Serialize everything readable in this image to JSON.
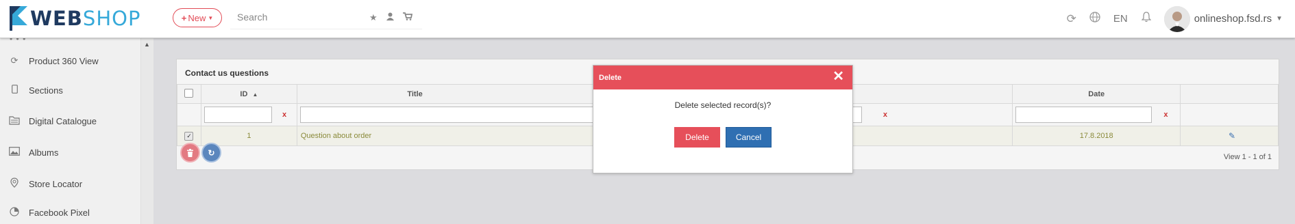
{
  "brand": {
    "part1": "WEB",
    "part2": "SHOP"
  },
  "header": {
    "new_label": "New",
    "search_placeholder": "Search",
    "language": "EN",
    "user_name": "onlineshop.fsd.rs"
  },
  "sidebar": {
    "items": [
      {
        "label": "Product 360 View",
        "icon": "refresh-icon"
      },
      {
        "label": "Sections",
        "icon": "mobile-icon"
      },
      {
        "label": "Digital Catalogue",
        "icon": "catalogue-icon"
      },
      {
        "label": "Albums",
        "icon": "image-icon"
      },
      {
        "label": "Store Locator",
        "icon": "map-icon"
      },
      {
        "label": "Facebook Pixel",
        "icon": "pie-chart-icon"
      }
    ]
  },
  "grid": {
    "title": "Contact us questions",
    "columns": {
      "id": "ID",
      "title": "Title",
      "date": "Date"
    },
    "filter_clear": "x",
    "rows": [
      {
        "id": "1",
        "title": "Question about order",
        "date": "17.8.2018",
        "checked": true
      }
    ],
    "view_info": "View 1 - 1 of 1"
  },
  "modal": {
    "title": "Delete",
    "message": "Delete selected record(s)?",
    "delete_label": "Delete",
    "cancel_label": "Cancel",
    "close_glyph": "✕"
  },
  "colors": {
    "accent_red": "#e64f5a",
    "accent_blue": "#2f6fb2",
    "brand_dark": "#1f3a60",
    "brand_light": "#36a9d9"
  }
}
